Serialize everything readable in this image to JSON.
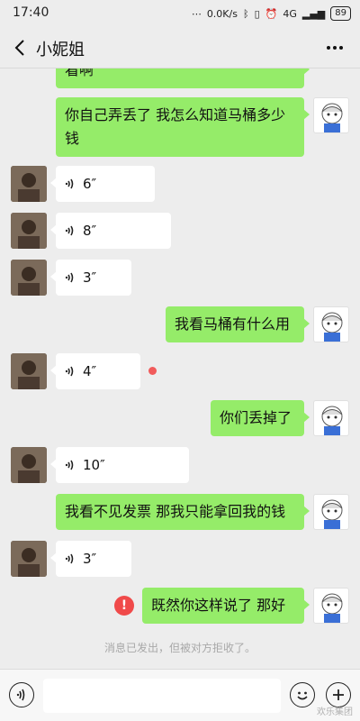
{
  "status_bar": {
    "time": "17:40",
    "speed": "0.0K/s",
    "network": "4G",
    "battery": "89"
  },
  "header": {
    "title": "小妮姐"
  },
  "messages": [
    {
      "side": "right",
      "type": "text",
      "text": "看啊"
    },
    {
      "side": "right",
      "type": "text",
      "text": "你自己弄丢了  我怎么知道马桶多少钱"
    },
    {
      "side": "left",
      "type": "voice",
      "duration": "6″"
    },
    {
      "side": "left",
      "type": "voice",
      "duration": "8″"
    },
    {
      "side": "left",
      "type": "voice",
      "duration": "3″"
    },
    {
      "side": "right",
      "type": "text",
      "text": "我看马桶有什么用"
    },
    {
      "side": "left",
      "type": "voice",
      "duration": "4″",
      "unread": true
    },
    {
      "side": "right",
      "type": "text",
      "text": "你们丢掉了"
    },
    {
      "side": "left",
      "type": "voice",
      "duration": "10″"
    },
    {
      "side": "right",
      "type": "text",
      "text": "我看不见发票  那我只能拿回我的钱"
    },
    {
      "side": "left",
      "type": "voice",
      "duration": "3″"
    },
    {
      "side": "right",
      "type": "text",
      "text": "既然你这样说了  那好",
      "failed": true
    }
  ],
  "system_note": "消息已发出，但被对方拒收了。",
  "input_bar": {
    "placeholder": ""
  },
  "watermark": "欢乐集团",
  "colors": {
    "bubble_self": "#95ec69",
    "bubble_other": "#ffffff",
    "background": "#ededed",
    "error": "#f04a4a"
  }
}
